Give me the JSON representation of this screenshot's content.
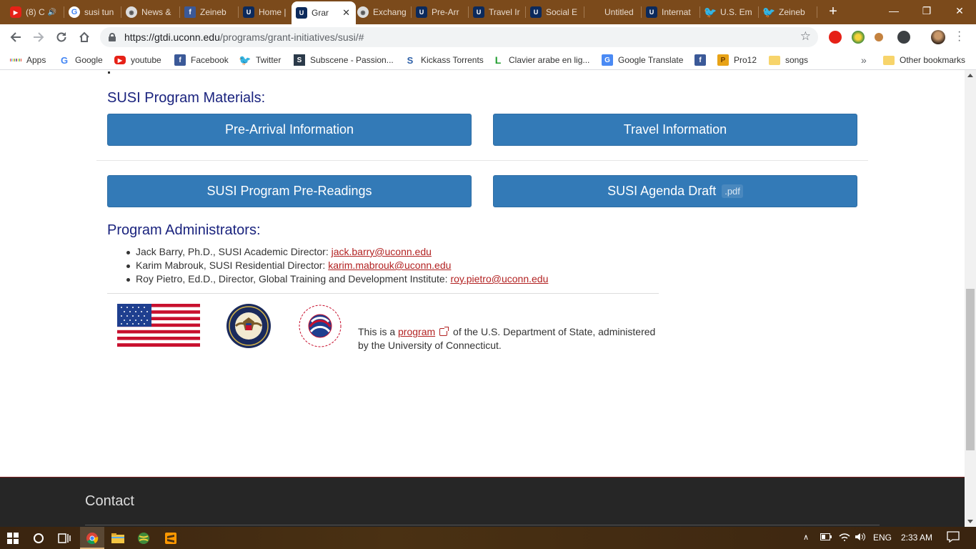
{
  "tabs": [
    {
      "label": "(8) C",
      "icon": "youtube-icon",
      "cls": "yt",
      "glyph": "▶",
      "extra": "🔊"
    },
    {
      "label": "susi tun",
      "icon": "google-icon",
      "cls": "g",
      "glyph": "G"
    },
    {
      "label": "News &",
      "icon": "seal-icon",
      "cls": "seal",
      "glyph": "◉"
    },
    {
      "label": "Zeineb",
      "icon": "facebook-icon",
      "cls": "fb",
      "glyph": "f"
    },
    {
      "label": "Home |",
      "icon": "uconn-icon",
      "cls": "uc",
      "glyph": "U"
    },
    {
      "label": "Grar",
      "icon": "uconn-icon",
      "cls": "uc",
      "glyph": "U",
      "active": true
    },
    {
      "label": "Exchang",
      "icon": "seal-icon",
      "cls": "seal",
      "glyph": "◉"
    },
    {
      "label": "Pre-Arr",
      "icon": "uconn-icon",
      "cls": "uc",
      "glyph": "U"
    },
    {
      "label": "Travel Ir",
      "icon": "uconn-icon",
      "cls": "uc",
      "glyph": "U"
    },
    {
      "label": "Social E",
      "icon": "uconn-icon",
      "cls": "uc",
      "glyph": "U"
    },
    {
      "label": "Untitled",
      "icon": "blank-icon",
      "cls": "",
      "glyph": ""
    },
    {
      "label": "Internat",
      "icon": "uconn-icon",
      "cls": "uc",
      "glyph": "U"
    },
    {
      "label": "U.S. Em",
      "icon": "twitter-icon",
      "cls": "tw",
      "glyph": "🐦"
    },
    {
      "label": "Zeineb",
      "icon": "twitter-icon",
      "cls": "tw",
      "glyph": "🐦"
    }
  ],
  "window": {
    "minimize": "—",
    "maximize": "❐",
    "close": "✕",
    "new_tab": "+"
  },
  "url": {
    "host": "https://gtdi.uconn.edu",
    "path": "/programs/grant-initiatives/susi/#"
  },
  "bookmarks": [
    {
      "label": "Apps"
    },
    {
      "label": "Google"
    },
    {
      "label": "youtube"
    },
    {
      "label": "Facebook"
    },
    {
      "label": "Twitter"
    },
    {
      "label": "Subscene - Passion..."
    },
    {
      "label": "Kickass Torrents"
    },
    {
      "label": "Clavier arabe en lig..."
    },
    {
      "label": "Google Translate"
    },
    {
      "label": ""
    },
    {
      "label": "Pro12"
    },
    {
      "label": "songs"
    }
  ],
  "bookmarks_more": "»",
  "other_bookmarks": "Other bookmarks",
  "content": {
    "materials_heading": "SUSI Program Materials:",
    "buttons": {
      "pre_arrival": "Pre-Arrival Information",
      "travel": "Travel Information",
      "pre_readings": "SUSI Program Pre-Readings",
      "agenda": "SUSI Agenda Draft",
      "agenda_badge": ".pdf"
    },
    "admins_heading": "Program Administrators:",
    "admins": [
      {
        "text": "Jack Barry, Ph.D., SUSI Academic Director: ",
        "email": "jack.barry@uconn.edu"
      },
      {
        "text": "Karim Mabrouk, SUSI Residential Director: ",
        "email": "karim.mabrouk@uconn.edu"
      },
      {
        "text": "Roy Pietro, Ed.D., Director, Global Training and Development Institute: ",
        "email": "roy.pietro@uconn.edu"
      }
    ],
    "footnote": {
      "before": "This is a ",
      "link": "program",
      "after": " of the U.S. Department of State, administered by the University of Connecticut."
    },
    "footer_heading": "Contact"
  },
  "taskbar": {
    "lang": "ENG",
    "time": "2:33 AM"
  },
  "colors": {
    "accent_button": "#337ab7",
    "heading": "#1a237e",
    "link": "#b22222",
    "tabstrip": "#7b4a1b"
  }
}
